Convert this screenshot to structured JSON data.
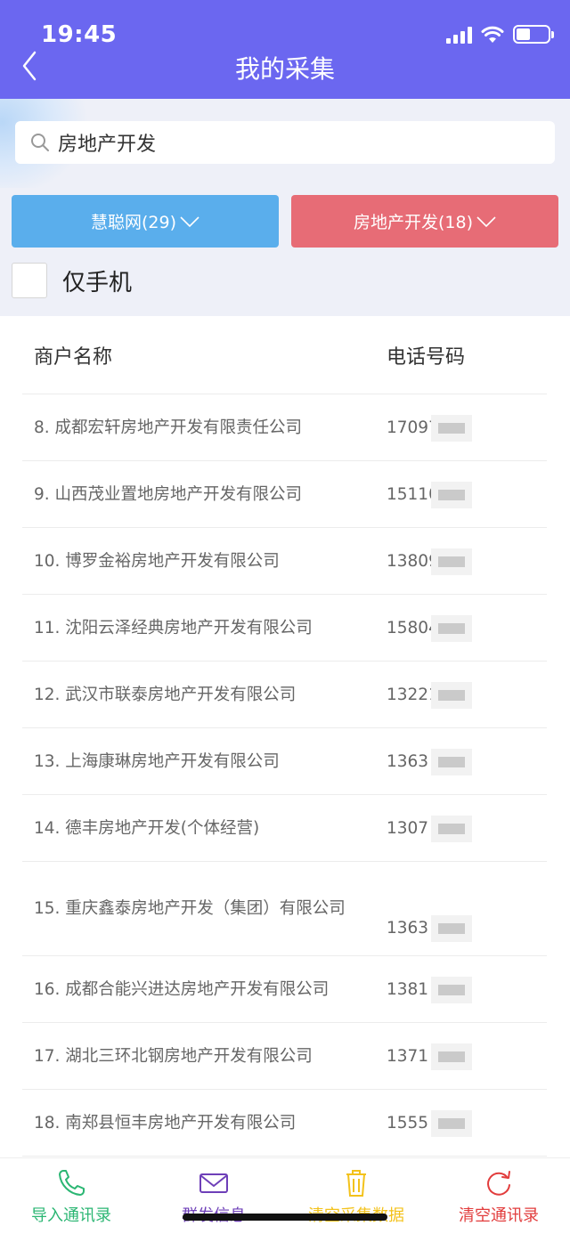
{
  "status_bar": {
    "time": "19:45"
  },
  "nav": {
    "title": "我的采集"
  },
  "search": {
    "value": "房地产开发"
  },
  "filters": {
    "left": "慧聪网(29)",
    "right": "房地产开发(18)"
  },
  "checkbox": {
    "label": "仅手机"
  },
  "table": {
    "headers": {
      "name": "商户名称",
      "phone": "电话号码"
    },
    "rows": [
      {
        "name": "8. 成都宏轩房地产开发有限责任公司",
        "phone": "17097     45"
      },
      {
        "name": "9. 山西茂业置地房地产开发有限公司",
        "phone": "15110     75"
      },
      {
        "name": "10. 博罗金裕房地产开发有限公司",
        "phone": "13809     08"
      },
      {
        "name": "11. 沈阳云泽经典房地产开发有限公司",
        "phone": "15804     73"
      },
      {
        "name": "12. 武汉市联泰房地产开发有限公司",
        "phone": "13221     07"
      },
      {
        "name": "13. 上海康琳房地产开发有限公司",
        "phone": "1363     269"
      },
      {
        "name": "14. 德丰房地产开发(个体经营)",
        "phone": "1307     937"
      },
      {
        "name": "15. 重庆鑫泰房地产开发（集团）有限公司",
        "phone": "1363     988"
      },
      {
        "name": "16. 成都合能兴进达房地产开发有限公司",
        "phone": "1381     580"
      },
      {
        "name": "17. 湖北三环北钢房地产开发有限公司",
        "phone": "1371     893"
      },
      {
        "name": "18. 南郑县恒丰房地产开发有限公司",
        "phone": "1555     416"
      }
    ]
  },
  "bottom_tabs": [
    {
      "label": "导入通讯录",
      "icon": "phone-icon",
      "color": "#2bb673"
    },
    {
      "label": "群发信息",
      "icon": "mail-icon",
      "color": "#6e3fb8"
    },
    {
      "label": "清空采集数据",
      "icon": "trash-icon",
      "color": "#f3c21b"
    },
    {
      "label": "清空通讯录",
      "icon": "refresh-icon",
      "color": "#e23c3c"
    }
  ],
  "colors": {
    "header": "#6b67f0",
    "filter_left": "#5aaeec",
    "filter_right": "#e76c76"
  }
}
